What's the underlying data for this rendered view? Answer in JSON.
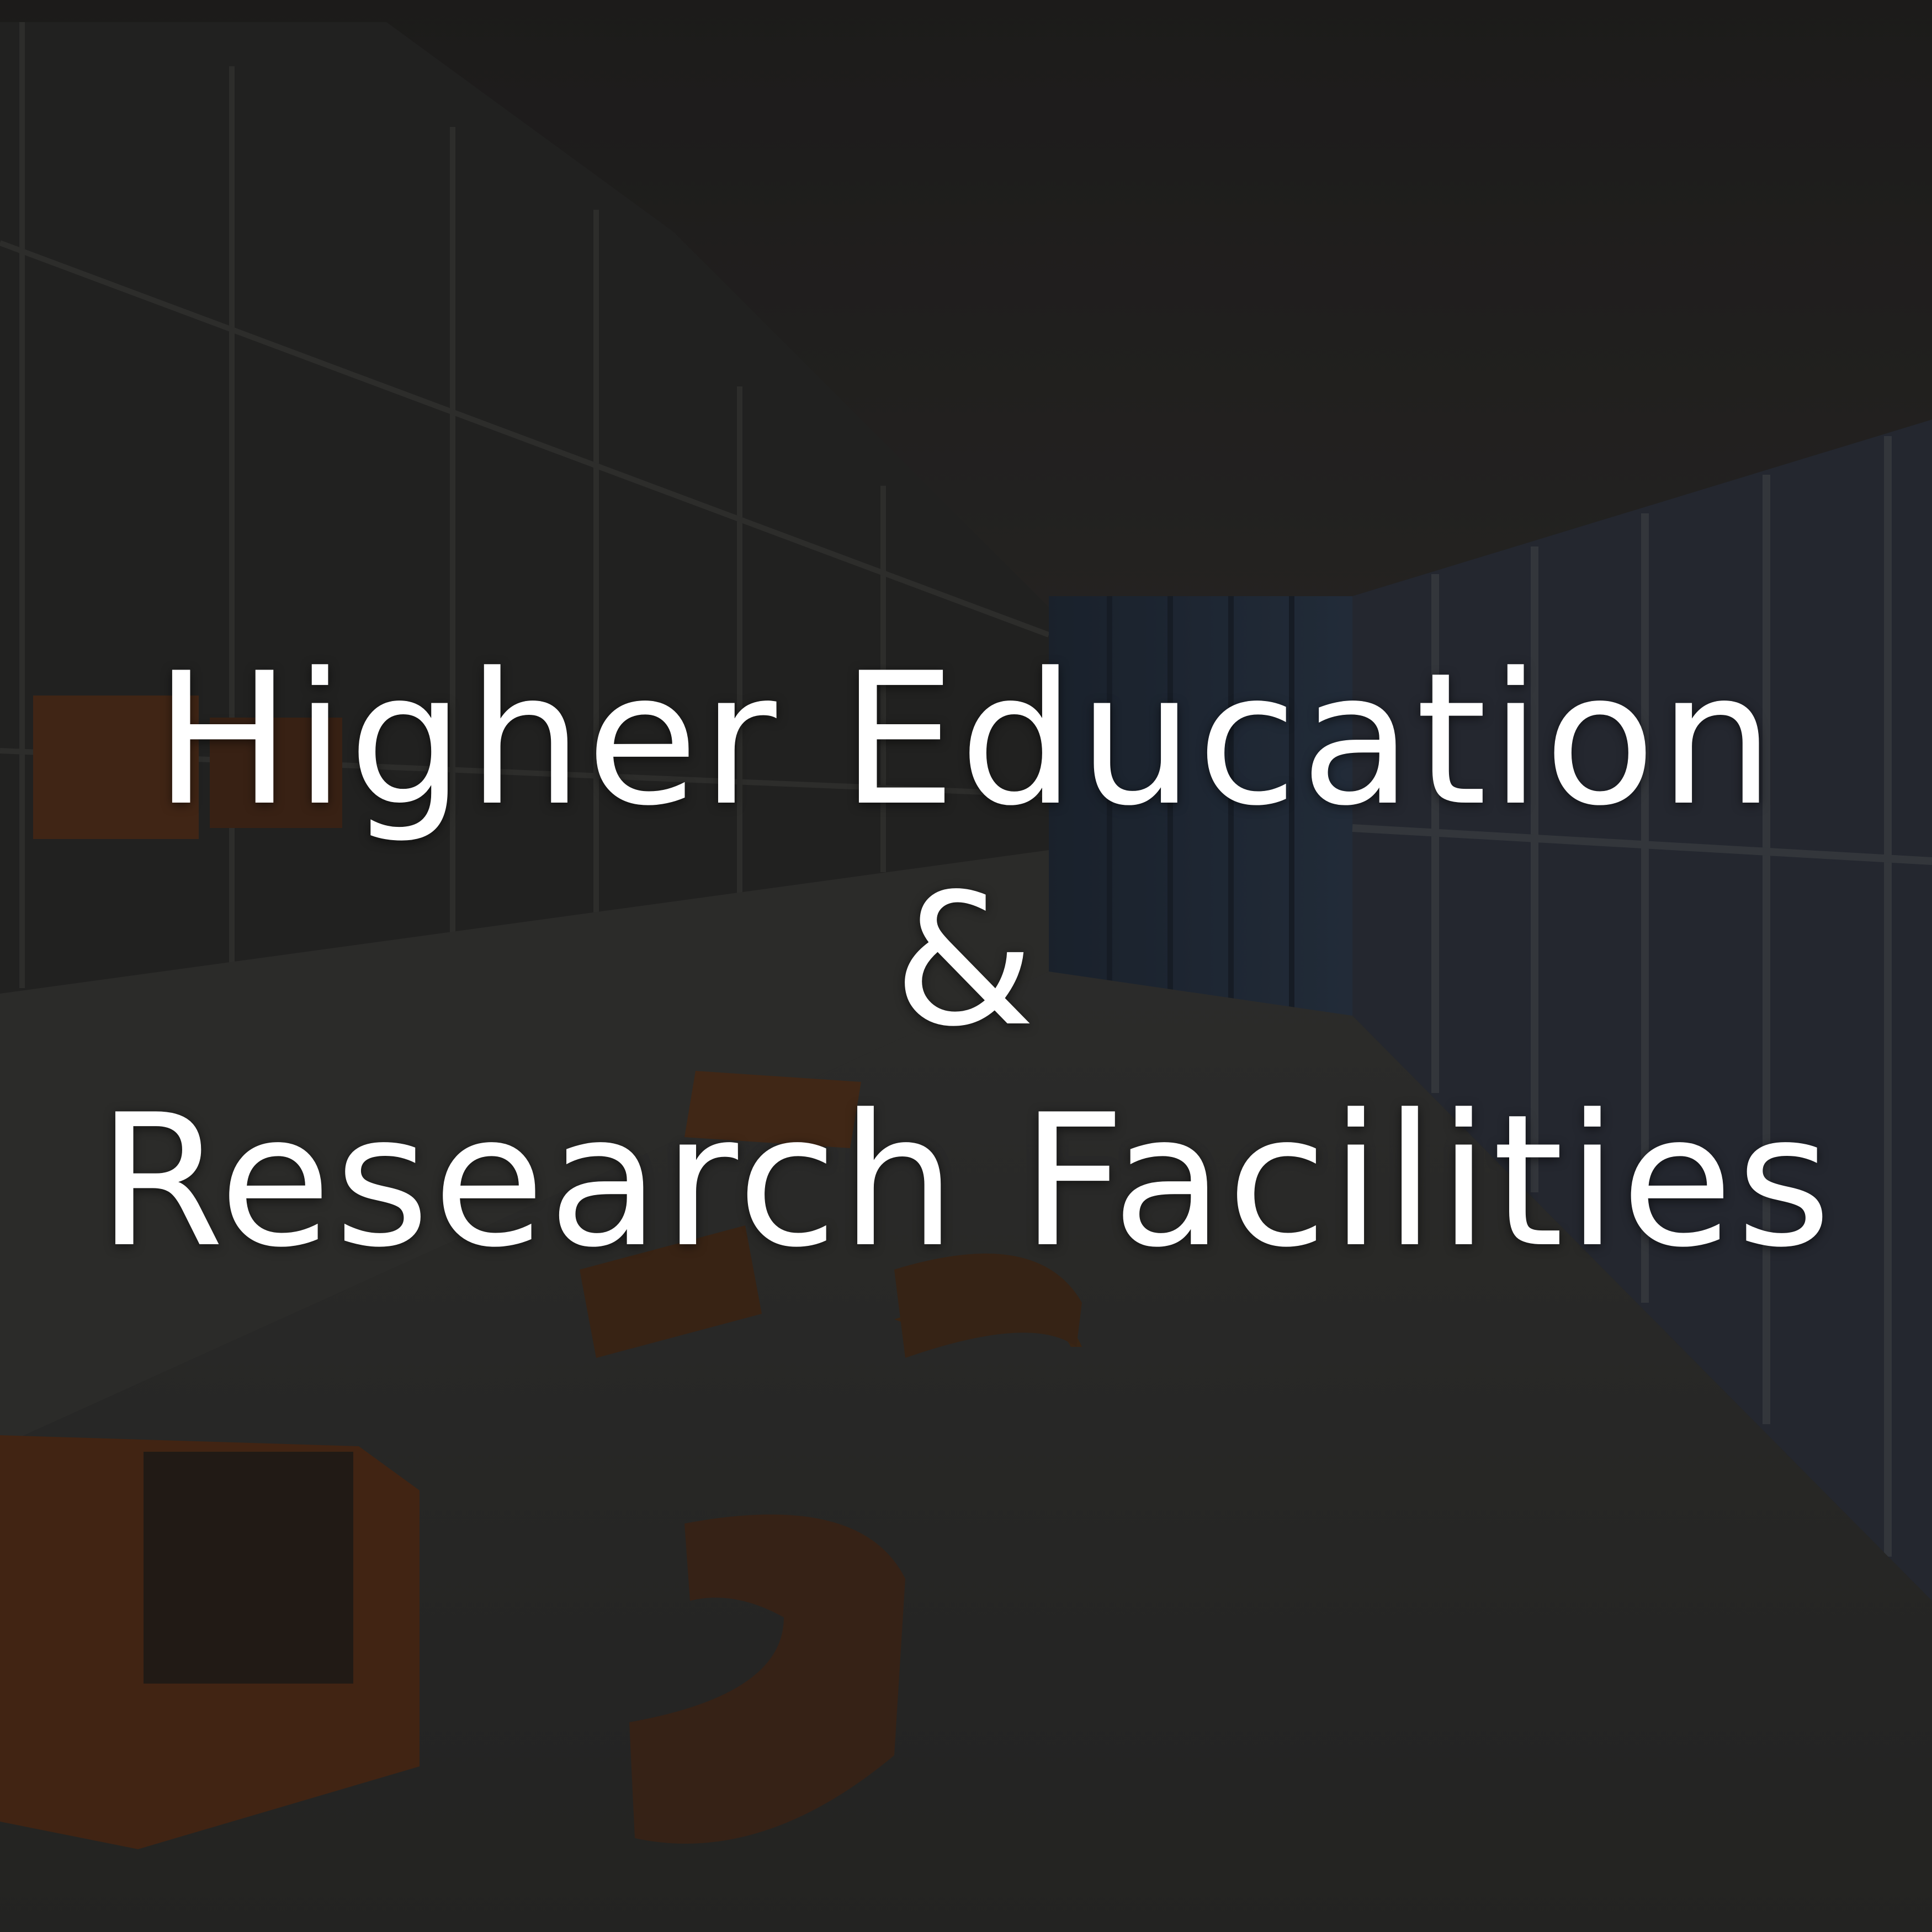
{
  "tile": {
    "title_line1": "Higher Education",
    "title_line2": "&",
    "title_line3": "Research Facilities"
  },
  "colors": {
    "text": "#ffffff",
    "overlay": "#121212",
    "accent_furniture": "#c7561c"
  }
}
